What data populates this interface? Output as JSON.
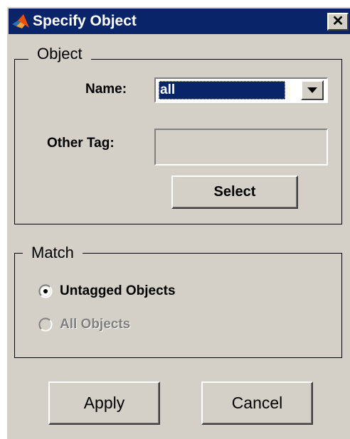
{
  "window": {
    "title": "Specify Object",
    "close_glyph": "✕"
  },
  "object_group": {
    "legend": "Object",
    "name_label": "Name:",
    "name_value": "all",
    "other_tag_label": "Other Tag:",
    "other_tag_value": "",
    "select_label": "Select"
  },
  "match_group": {
    "legend": "Match",
    "options": [
      {
        "label": "Untagged Objects",
        "selected": true,
        "enabled": true
      },
      {
        "label": "All Objects",
        "selected": false,
        "enabled": false
      }
    ]
  },
  "footer": {
    "apply_label": "Apply",
    "cancel_label": "Cancel"
  },
  "colors": {
    "titlebar": "#0a246a",
    "face": "#d4d0c8",
    "selection": "#0a246a"
  },
  "icons": {
    "app": "matlab-logo-icon",
    "close": "close-icon",
    "dropdown": "chevron-down-icon"
  }
}
